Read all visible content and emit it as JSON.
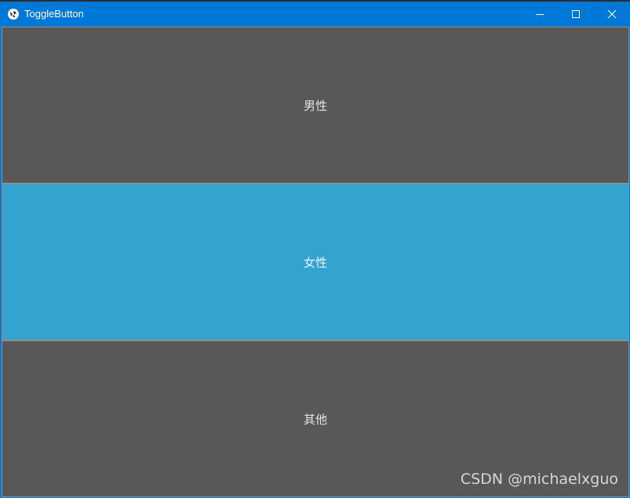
{
  "window": {
    "title": "ToggleButton",
    "app_icon": "kivy-logo-icon",
    "controls": [
      "minimize-icon",
      "maximize-icon",
      "close-icon"
    ]
  },
  "toggle_buttons": [
    {
      "label": "男性",
      "state": "normal"
    },
    {
      "label": "女性",
      "state": "down"
    },
    {
      "label": "其他",
      "state": "normal"
    }
  ],
  "colors": {
    "titlebar": "#0078d7",
    "button_normal": "#585858",
    "button_down": "#33a3d0"
  },
  "watermark": "CSDN @michaelxguo"
}
